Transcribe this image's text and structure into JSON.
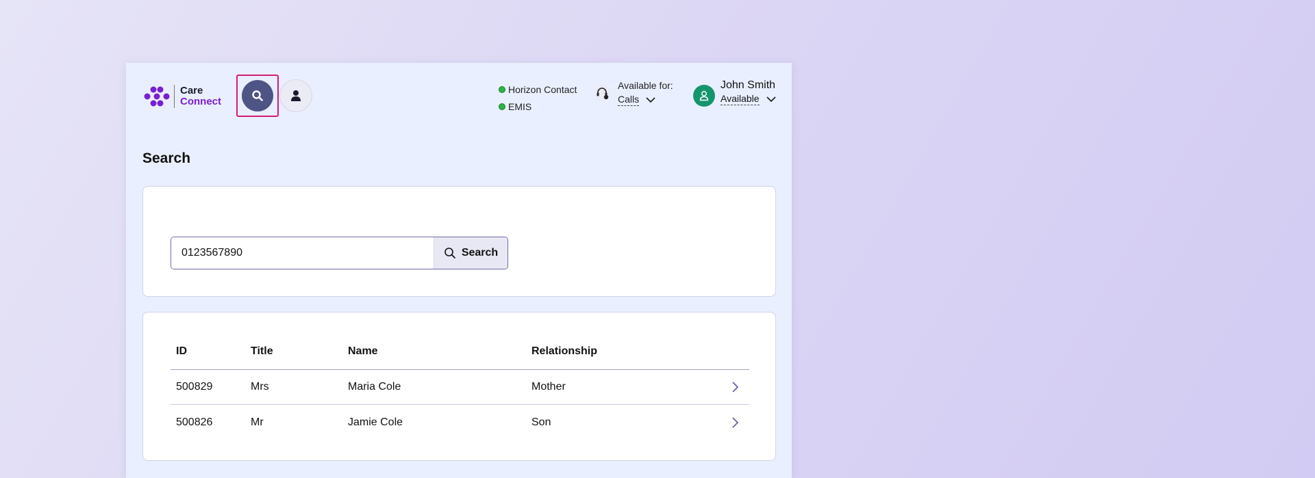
{
  "app": {
    "logo": {
      "line1": "Care",
      "line2": "Connect"
    },
    "nav": {
      "search_icon": "search-icon",
      "person_icon": "person-icon"
    },
    "systems": [
      {
        "label": "Horizon Contact",
        "status_color": "#2fb34a"
      },
      {
        "label": "EMIS",
        "status_color": "#2fb34a"
      }
    ],
    "availability": {
      "label": "Available for:",
      "value": "Calls",
      "icon": "headset-icon"
    },
    "user": {
      "name": "John Smith",
      "status": "Available",
      "avatar_color": "#16956c"
    },
    "colors": {
      "accent": "#7a1fd1",
      "nav_active": "#4e5485",
      "focus_ring": "#d6197a"
    }
  },
  "page": {
    "title": "Search"
  },
  "search": {
    "value": "0123567890",
    "button_label": "Search"
  },
  "results": {
    "columns": [
      "ID",
      "Title",
      "Name",
      "Relationship"
    ],
    "rows": [
      {
        "id": "500829",
        "title": "Mrs",
        "name": "Maria Cole",
        "relationship": "Mother"
      },
      {
        "id": "500826",
        "title": "Mr",
        "name": "Jamie Cole",
        "relationship": "Son"
      }
    ]
  }
}
